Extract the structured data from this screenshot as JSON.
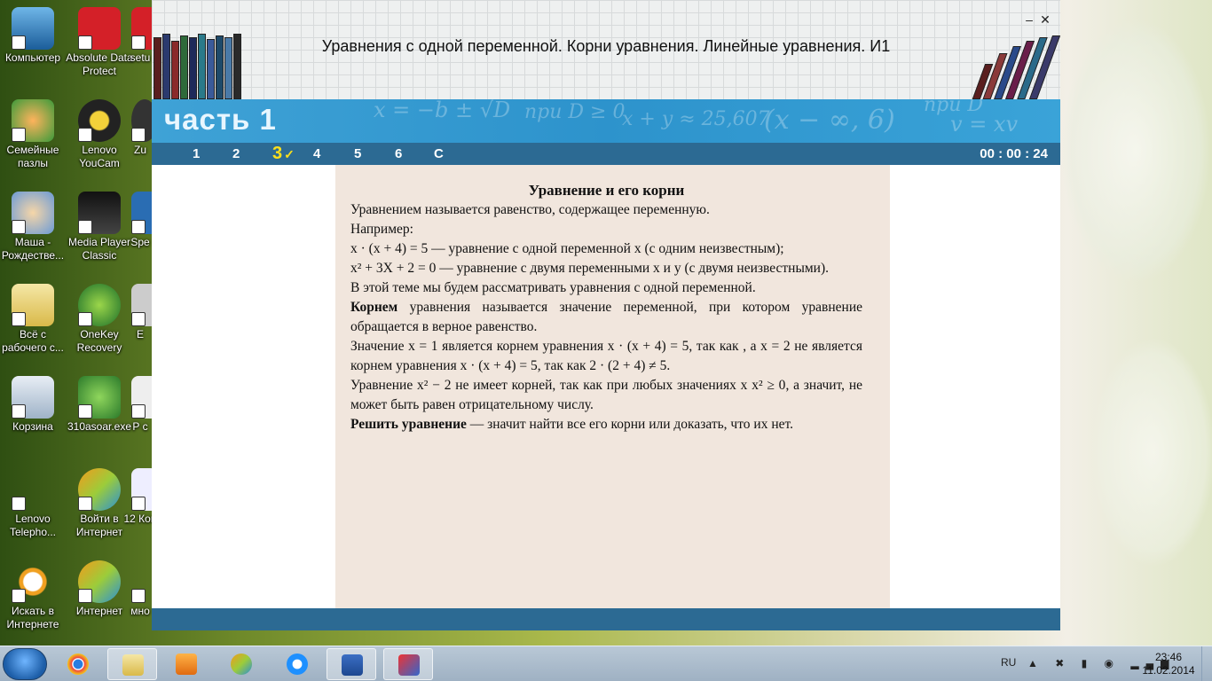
{
  "desktop": {
    "icons": [
      {
        "label": "Компьютер"
      },
      {
        "label": "Absolute Data Protect"
      },
      {
        "label": "setu"
      },
      {
        "label": "Семейные пазлы"
      },
      {
        "label": "Lenovo YouCam"
      },
      {
        "label": "Zu"
      },
      {
        "label": "Маша - Рождестве..."
      },
      {
        "label": "Media Player Classic"
      },
      {
        "label": "Spe"
      },
      {
        "label": "Всё с рабочего с..."
      },
      {
        "label": "OneKey Recovery"
      },
      {
        "label": "E"
      },
      {
        "label": "Корзина"
      },
      {
        "label": "310asoar.exe"
      },
      {
        "label": "Р с"
      },
      {
        "label": "Lenovo Telepho..."
      },
      {
        "label": "Войти в Интернет"
      },
      {
        "label": "12 Кон"
      },
      {
        "label": "Искать в Интернете"
      },
      {
        "label": "Интернет"
      },
      {
        "label": "мно"
      }
    ]
  },
  "app": {
    "title": "Уравнения с одной переменной. Корни уравнения. Линейные уравнения. И1",
    "window_controls": {
      "minimize": "–",
      "close": "✕"
    },
    "banner": {
      "part_title": "часть 1",
      "decor": [
        "x = −b ± √D",
        "при D ≥ 0",
        "x + y ≈ 25,607",
        "(x − ∞, 6)",
        "при D",
        "v = xv"
      ]
    },
    "nav": {
      "tabs": [
        "1",
        "2",
        "3",
        "4",
        "5",
        "6",
        "С"
      ],
      "active_tab": "3",
      "check_mark": "✓",
      "timer": "00 : 00 : 24"
    },
    "lesson": {
      "heading": "Уравнение и его корни",
      "p1": "Уравнением называется равенство, содержащее переменную.",
      "p2": "Например:",
      "ex1_math": "x · (x + 4) = 5",
      "ex1_text": " — уравнение с одной переменной x (с одним неизвестным);",
      "ex2_math": "x² + 3X + 2 = 0",
      "ex2_text": " — уравнение с двумя переменными x и y (с двумя неизвестными).",
      "p3": "В этой теме мы будем рассматривать уравнения с одной переменной.",
      "p4_bold": "Корнем",
      "p4_rest": " уравнения называется значение переменной, при котором уравнение обращается в верное равенство.",
      "p5_a": "Значение x = 1 является корнем уравнения ",
      "p5_math1": "x · (x + 4) = 5",
      "p5_b": ", так как , а x = 2 не является корнем уравнения ",
      "p5_math2": "x · (x + 4) = 5",
      "p5_c": ", так как ",
      "p5_math3": "2 · (2 + 4) ≠ 5",
      "p5_d": ".",
      "p6_a": "Уравнение ",
      "p6_math1": "x² − 2",
      "p6_b": " не имеет корней, так как при любых значениях x ",
      "p6_math2": "x² ≥ 0",
      "p6_c": ", а значит, не может быть равен отрицательному числу.",
      "p7_bold": "Решить уравнение",
      "p7_rest": " — значит найти все его корни или доказать, что их нет."
    }
  },
  "taskbar": {
    "lang": "RU",
    "tray": "▲ ✖ ▮ ◉ ▂▄▆",
    "time": "23:46",
    "date": "11.02.2014",
    "apps": [
      "chrome",
      "explorer",
      "media-player",
      "internet",
      "internet-explorer",
      "word",
      "app"
    ]
  },
  "colors": {
    "nav": "#2c6a93",
    "banner": "#3fa2d6",
    "paper": "#f1e6dd",
    "active_tab": "#ffe01a"
  }
}
